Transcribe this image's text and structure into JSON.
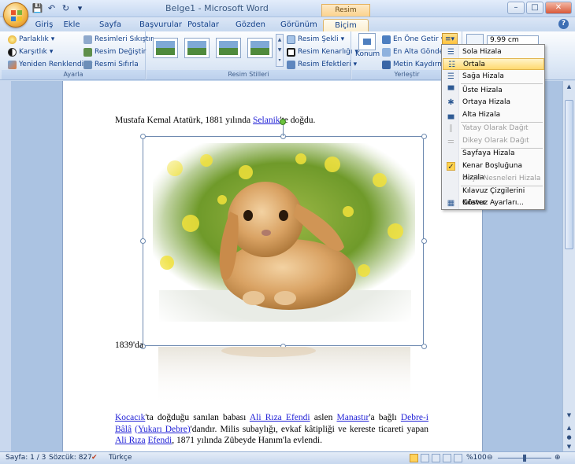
{
  "window": {
    "title": "Belge1 - Microsoft Word",
    "tools_title": "Resim Araçları"
  },
  "tabs": [
    "Giriş",
    "Ekle",
    "Sayfa Düzeni",
    "Başvurular",
    "Postalar",
    "Gözden Geçir",
    "Görünüm",
    "Biçim"
  ],
  "ribbon": {
    "ayarla": {
      "label": "Ayarla",
      "parlaklik": "Parlaklık",
      "karsitlik": "Karşıtlık",
      "yeniden": "Yeniden Renklendir",
      "sikistir": "Resimleri Sıkıştır",
      "degistir": "Resim Değiştir",
      "sifirla": "Resmi Sıfırla"
    },
    "stiller": {
      "label": "Resim Stilleri",
      "sekil": "Resim Şekli",
      "kenarlik": "Resim Kenarlığı",
      "efektleri": "Resim Efektleri"
    },
    "yerlestir": {
      "label": "Yerleştir",
      "konum": "Konum",
      "en_one": "En Öne Getir",
      "en_alta": "En Alta Gönder",
      "kaydirma": "Metin Kaydırma",
      "size": "9.99 cm"
    }
  },
  "menu": {
    "items": [
      {
        "label": "Sola Hizala",
        "state": "normal"
      },
      {
        "label": "Ortala",
        "state": "hover"
      },
      {
        "label": "Sağa Hizala",
        "state": "normal"
      },
      {
        "label": "Üste Hizala",
        "state": "normal"
      },
      {
        "label": "Ortaya Hizala",
        "state": "normal"
      },
      {
        "label": "Alta Hizala",
        "state": "normal"
      },
      {
        "label": "Yatay Olarak Dağıt",
        "state": "disabled"
      },
      {
        "label": "Dikey Olarak Dağıt",
        "state": "disabled"
      },
      {
        "label": "Sayfaya Hizala",
        "state": "normal"
      },
      {
        "label": "Kenar Boşluğuna Hizala",
        "state": "checked"
      },
      {
        "label": "Seçili Nesneleri Hizala",
        "state": "disabled"
      },
      {
        "label": "Kılavuz Çizgilerini Göster",
        "state": "normal"
      },
      {
        "label": "Kılavuz Ayarları...",
        "state": "normal"
      }
    ]
  },
  "doc": {
    "line1_pre": "Mustafa Kemal Atatürk, 1881 yılında ",
    "line1_link": "Selanik",
    "line1_post": "'te doğdu.",
    "line2": "1839'da",
    "p_link1": "Kocacık",
    "p_t1": "'ta doğduğu sanılan babası ",
    "p_link2": "Ali Rıza Efendi",
    "p_t2": " aslen ",
    "p_link3": "Manastır",
    "p_t3": "'a bağlı ",
    "p_link4": "Debre-i Bâlâ",
    "p_link5": "(Yukarı Debre)",
    "p_t4": "'dandır. Milis subaylığı, evkaf kâtipliği ve kereste ticareti yapan ",
    "p_link6": "Ali Rıza",
    "p_link7": "Efendi",
    "p_t5": ", 1871 yılında Zübeyde Hanım'la evlendi."
  },
  "status": {
    "page": "Sayfa: 1 / 3",
    "words": "Sözcük: 827",
    "lang": "Türkçe",
    "zoom": "%100"
  }
}
